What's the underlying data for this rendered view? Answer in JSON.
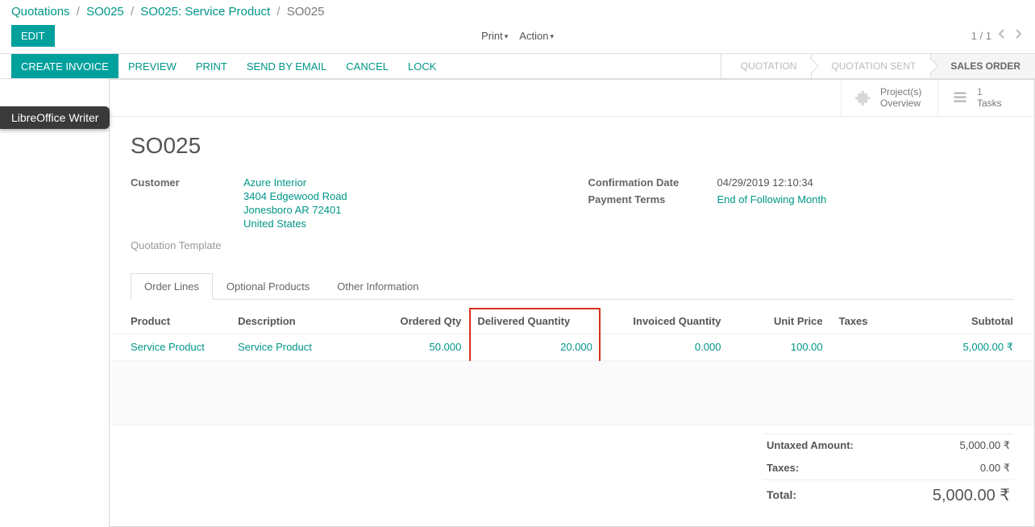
{
  "breadcrumb": {
    "items": [
      "Quotations",
      "SO025",
      "SO025: Service Product"
    ],
    "current": "SO025"
  },
  "buttons": {
    "edit": "EDIT",
    "print": "Print",
    "action": "Action",
    "create_invoice": "CREATE INVOICE",
    "preview": "PREVIEW",
    "print_tb": "PRINT",
    "send_email": "SEND BY EMAIL",
    "cancel": "CANCEL",
    "lock": "LOCK"
  },
  "pager": {
    "text": "1 / 1"
  },
  "stages": {
    "quotation": "QUOTATION",
    "quotation_sent": "QUOTATION SENT",
    "sales_order": "SALES ORDER"
  },
  "overlay": {
    "libreoffice": "LibreOffice Writer"
  },
  "stat": {
    "projects_l1": "Project(s)",
    "projects_l2": "Overview",
    "tasks_num": "1",
    "tasks_label": "Tasks"
  },
  "record": {
    "name": "SO025",
    "labels": {
      "customer": "Customer",
      "quotation_template": "Quotation Template",
      "confirmation_date": "Confirmation Date",
      "payment_terms": "Payment Terms"
    },
    "customer_name": "Azure Interior",
    "addr1": "3404 Edgewood Road",
    "addr2": "Jonesboro AR 72401",
    "addr3": "United States",
    "confirmation_date": "04/29/2019 12:10:34",
    "payment_terms": "End of Following Month"
  },
  "tabs": {
    "order_lines": "Order Lines",
    "optional_products": "Optional Products",
    "other_information": "Other Information"
  },
  "table": {
    "headers": {
      "product": "Product",
      "description": "Description",
      "ordered_qty": "Ordered Qty",
      "delivered_qty": "Delivered Quantity",
      "invoiced_qty": "Invoiced Quantity",
      "unit_price": "Unit Price",
      "taxes": "Taxes",
      "subtotal": "Subtotal"
    },
    "row": {
      "product": "Service Product",
      "description": "Service Product",
      "ordered_qty": "50.000",
      "delivered_qty": "20.000",
      "invoiced_qty": "0.000",
      "unit_price": "100.00",
      "taxes": "",
      "subtotal": "5,000.00 ₹"
    }
  },
  "totals": {
    "untaxed_label": "Untaxed Amount:",
    "untaxed_value": "5,000.00 ₹",
    "taxes_label": "Taxes:",
    "taxes_value": "0.00 ₹",
    "total_label": "Total:",
    "total_value": "5,000.00 ₹"
  }
}
